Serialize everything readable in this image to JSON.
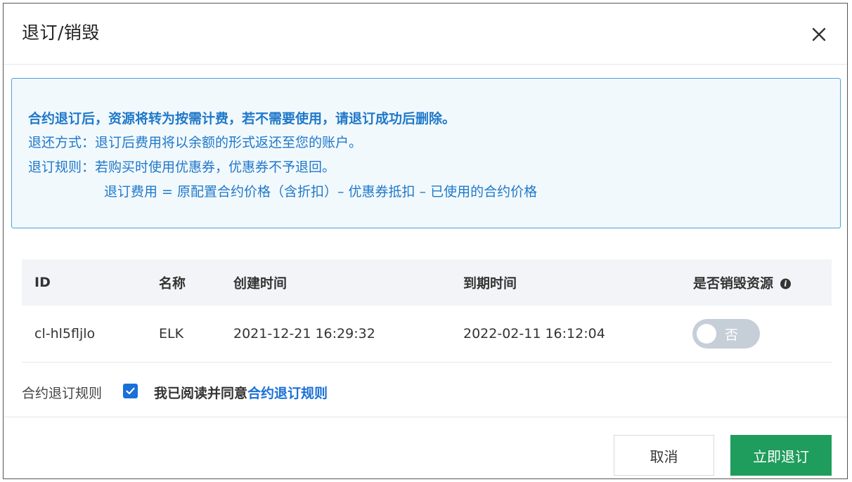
{
  "dialog": {
    "title": "退订/销毁"
  },
  "notice": {
    "headline": "合约退订后，资源将转为按需计费，若不需要使用，请退订成功后删除。",
    "refund_method": "退还方式：退订后费用将以余额的形式返还至您的账户。",
    "refund_rules": "退订规则：若购买时使用优惠券，优惠券不予退回。",
    "fee_formula": "退订费用 = 原配置合约价格（含折扣）– 优惠券抵扣 – 已使用的合约价格"
  },
  "table": {
    "headers": {
      "id": "ID",
      "name": "名称",
      "created": "创建时间",
      "expire": "到期时间",
      "destroy": "是否销毁资源"
    },
    "rows": [
      {
        "id": "cl-hl5fljlo",
        "name": "ELK",
        "created": "2021-12-21 16:29:32",
        "expire": "2022-02-11 16:12:04",
        "destroy_toggle_label": "否"
      }
    ]
  },
  "agreement": {
    "label": "合约退订规则",
    "checked": true,
    "text": "我已阅读并同意",
    "link": "合约退订规则"
  },
  "footer": {
    "cancel_label": "取消",
    "confirm_label": "立即退订"
  },
  "colors": {
    "notice_text": "#1f78c9",
    "notice_border": "#4a9fdc",
    "confirm_button": "#1f9d5c",
    "link": "#1a6fd8",
    "toggle_off": "#c6ced8"
  },
  "icons": {
    "close": "close-icon",
    "info": "info-icon",
    "check": "check-icon"
  }
}
